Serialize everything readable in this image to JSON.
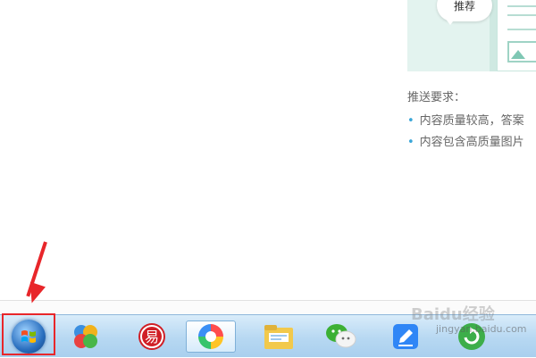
{
  "page": {
    "bubble_label": "推荐",
    "push_requirements_title": "推送要求：",
    "requirements": [
      {
        "bullet": "•",
        "text": "内容质量较高，答案"
      },
      {
        "bullet": "•",
        "text": "内容包含高质量图片"
      }
    ]
  },
  "taskbar": {
    "items": [
      {
        "name": "start-button",
        "icon": "windows-orb-icon"
      },
      {
        "name": "pinned-app-colorful-balls",
        "icon": "colorful-balls-icon"
      },
      {
        "name": "pinned-app-red-yi",
        "icon": "red-circle-icon",
        "glyph": "易"
      },
      {
        "name": "pinned-app-pinwheel",
        "icon": "pinwheel-icon",
        "active": true
      },
      {
        "name": "pinned-app-file-explorer",
        "icon": "folder-icon"
      },
      {
        "name": "pinned-app-wechat",
        "icon": "wechat-icon"
      },
      {
        "name": "pinned-app-blue-note",
        "icon": "blue-edit-icon"
      },
      {
        "name": "pinned-app-green",
        "icon": "green-circle-icon"
      }
    ]
  },
  "watermark": {
    "brand": "Baidu经验",
    "url": "jingyan.baidu.com"
  },
  "colors": {
    "highlight": "#e8262a",
    "taskbar_top": "#d9ecfa",
    "taskbar_bottom": "#a9cfee"
  }
}
